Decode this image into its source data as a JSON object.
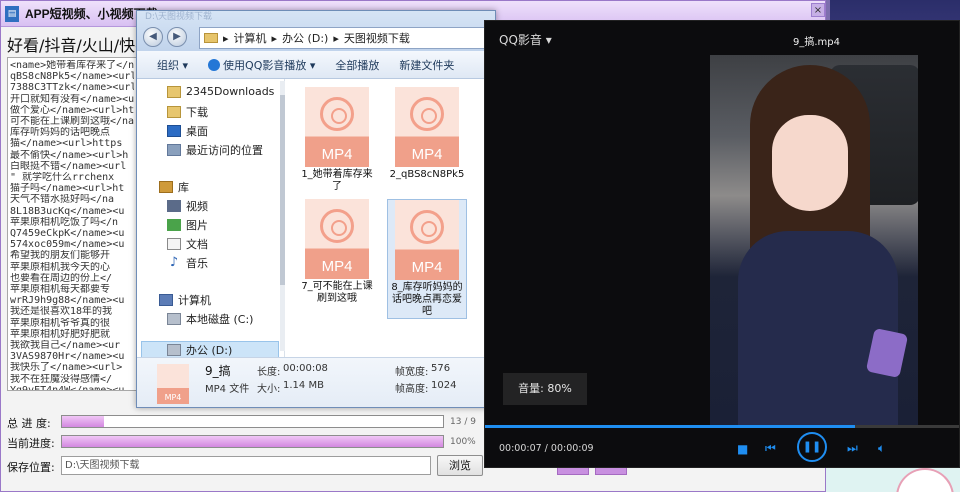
{
  "downloader": {
    "title": "APP短视频、小视频下载",
    "header_text": "好看/抖音/火山/快手/",
    "log_lines": [
      "<name>她带着库存来了</name><ur",
      "qBS8cN8Pk5</name><url>",
      "7388C3TTzk</name><url",
      "开口就知有没有</name><u",
      "做个爱心</name><url>ht",
      "可不能在上课刷到这哦</nam",
      "库存听妈妈的话吧晚点",
      "猫</name><url>https",
      "最不偷快</name><url>h",
      "白眼挺不错</name><url",
      "\" 就学吃什么rrchenx",
      "猫子吗</name><url>ht",
      "天气不错水挺好吗</na",
      "8L18B3ucKq</name><u",
      "苹果原相机吃饭了吗</n",
      "Q7459eCkpK</name><u",
      "574xoc059m</name><u",
      "希望我的朋友们能够开",
      "苹果原相机我今天的心",
      "也要看在周边的份上</",
      "苹果原相机每天都要专",
      "wrRJ9h9g88</name><u",
      "我还是很喜欢18年的我",
      "苹果原相机爷爷真的很",
      "苹果原相机好肥好肥就",
      "我欲我自己</name><ur",
      "3VAS9870Hr</name><u",
      "我快乐了</name><url>",
      "我不在狂魔没得感情</",
      "Yg9yET4n4W</name><u",
      "苹果原相机</name><ur",
      "高马尾今天是爷爷拍的"
    ],
    "total_progress_label": "总 进 度:",
    "total_progress_text": "13 / 9",
    "total_progress_fraction": 0.11,
    "current_progress_label": "当前进度:",
    "current_progress_text": "100%",
    "current_progress_fraction": 1.0,
    "save_label": "保存位置:",
    "save_path": "D:\\天图视频下载",
    "browse_label": "浏览",
    "accent": "#d388e0"
  },
  "explorer": {
    "ghost_title": "D:\\天图视频下载",
    "breadcrumb": [
      "计算机",
      "办公 (D:)",
      "天图视频下载"
    ],
    "toolbar": [
      "组织 ▾",
      "使用QQ影音播放 ▾",
      "全部播放",
      "新建文件夹"
    ],
    "nav": {
      "favorites": [
        "2345Downloads",
        "下载",
        "桌面",
        "最近访问的位置"
      ],
      "library_title": "库",
      "libraries": [
        "视频",
        "图片",
        "文档",
        "音乐"
      ],
      "computer_title": "计算机",
      "drives": [
        "本地磁盘 (C:)",
        "办公 (D:)"
      ]
    },
    "files": [
      {
        "label": "MP4",
        "name": "1_她带着库存来了"
      },
      {
        "label": "MP4",
        "name": "2_qBS8cN8Pk5"
      },
      {
        "label": "MP4",
        "name": "7_可不能在上课刷到这哦"
      },
      {
        "label": "MP4",
        "name": "8_库存听妈妈的话吧晚点再恋爱吧"
      }
    ],
    "status": {
      "thumb_label": "MP4",
      "filename": "9_搞",
      "filetype": "MP4 文件",
      "duration_label": "长度:",
      "duration": "00:00:08",
      "size_label": "大小:",
      "size": "1.14 MB",
      "width_label": "帧宽度:",
      "width": "576",
      "height_label": "帧高度:",
      "height": "1024"
    }
  },
  "player": {
    "app_name": "QQ影音 ▾",
    "file_name": "9_搞.mp4",
    "volume_text": "音量: 80%",
    "time_text": "00:00:07 / 00:00:09",
    "progress_fraction": 0.78,
    "accent": "#1f8ef1"
  }
}
